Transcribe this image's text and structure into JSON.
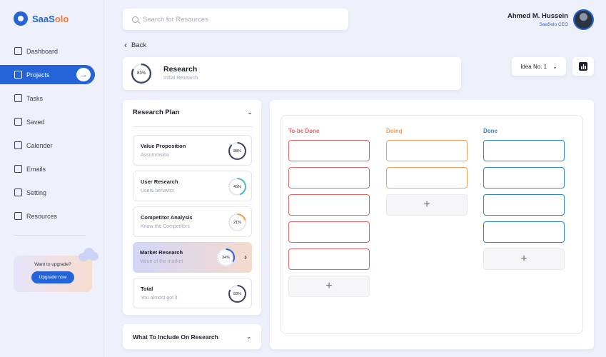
{
  "brand": {
    "name_a": "SaaS",
    "name_b": "olo"
  },
  "sidebar": {
    "items": [
      {
        "label": "Dashboard",
        "icon": "grid-icon"
      },
      {
        "label": "Projects",
        "icon": "edit-icon"
      },
      {
        "label": "Tasks",
        "icon": "tasks-icon"
      },
      {
        "label": "Saved",
        "icon": "bookmark-icon"
      },
      {
        "label": "Calender",
        "icon": "calendar-icon"
      },
      {
        "label": "Emails",
        "icon": "mail-icon"
      },
      {
        "label": "Setting",
        "icon": "gear-icon"
      },
      {
        "label": "Resources",
        "icon": "check-square-icon"
      }
    ],
    "active_index": 1,
    "upgrade": {
      "text": "Want to upgrade?",
      "button": "Upgrade now"
    }
  },
  "search": {
    "placeholder": "Search for Resources"
  },
  "user": {
    "name": "Ahmed M. Hussein",
    "role": "SaaSolo CEO"
  },
  "back_label": "Back",
  "research": {
    "title": "Research",
    "subtitle": "Initial Research",
    "progress": 83,
    "progress_label": "83%"
  },
  "idea_select": {
    "value": "Idea No. 1"
  },
  "plan": {
    "title": "Research Plan",
    "items": [
      {
        "title": "Value Proposition",
        "subtitle": "Assummsion",
        "progress": 88,
        "label": "88%",
        "color": "#3a4361"
      },
      {
        "title": "User Research",
        "subtitle": "Users behavior",
        "progress": 45,
        "label": "45%",
        "color": "#4fb8c3"
      },
      {
        "title": "Competitor Analysis",
        "subtitle": "Know the Competitors",
        "progress": 21,
        "label": "21%",
        "color": "#f09a54"
      },
      {
        "title": "Market Research",
        "subtitle": "Value of the market",
        "progress": 34,
        "label": "34%",
        "color": "#2563d9"
      },
      {
        "title": "Total",
        "subtitle": "You almost got it",
        "progress": 83,
        "label": "83%",
        "color": "#3a4361"
      }
    ],
    "selected_index": 3
  },
  "include": {
    "title": "What To Include On Research"
  },
  "board": {
    "columns": [
      {
        "title": "To-be Done",
        "color": "#e06767",
        "cards": 5
      },
      {
        "title": "Doing",
        "color": "#f0a060",
        "cards": 2
      },
      {
        "title": "Done",
        "color": "#2f86d6",
        "cards": 4
      }
    ]
  },
  "colors": {
    "accent": "#2563d9",
    "track": "#e4e7f2"
  }
}
